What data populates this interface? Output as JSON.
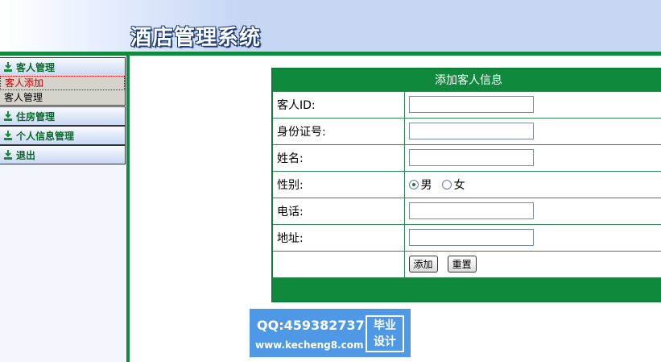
{
  "header": {
    "title": "酒店管理系统"
  },
  "sidebar": {
    "groups": [
      {
        "label": "客人管理",
        "items": [
          "客人添加",
          "客人管理"
        ]
      },
      {
        "label": "住房管理"
      },
      {
        "label": "个人信息管理"
      },
      {
        "label": "退出"
      }
    ]
  },
  "form": {
    "title": "添加客人信息",
    "fields": {
      "guest_id": {
        "label": "客人ID:",
        "value": ""
      },
      "id_number": {
        "label": "身份证号:",
        "value": ""
      },
      "name": {
        "label": "姓名:",
        "value": ""
      },
      "gender": {
        "label": "性别:",
        "options": [
          "男",
          "女"
        ],
        "selected": "男"
      },
      "phone": {
        "label": "电话:",
        "value": ""
      },
      "address": {
        "label": "地址:",
        "value": ""
      }
    },
    "buttons": {
      "add": "添加",
      "reset": "重置"
    }
  },
  "watermark": {
    "qq": "QQ:459382737",
    "url": "www.kecheng8.com",
    "tag_line1": "毕业",
    "tag_line2": "设计"
  },
  "colors": {
    "accent_green": "#0f8a3c",
    "header_blue": "#c6d6f3",
    "active_red": "#cc0000"
  }
}
